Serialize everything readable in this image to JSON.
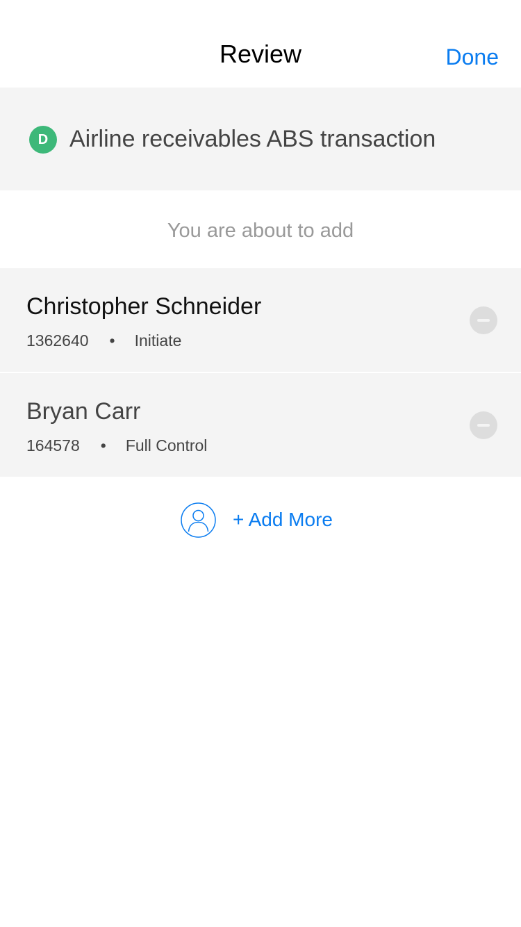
{
  "navbar": {
    "title": "Review",
    "done_label": "Done"
  },
  "deal": {
    "badge_letter": "D",
    "badge_color": "#3db879",
    "title": "Airline receivables ABS transaction"
  },
  "section": {
    "label": "You are about to add"
  },
  "users": [
    {
      "name": "Christopher Schneider",
      "id": "1362640",
      "separator": "•",
      "permission": "Initiate"
    },
    {
      "name": "Bryan Carr",
      "id": "164578",
      "separator": "•",
      "permission": "Full Control"
    }
  ],
  "add_more": {
    "icon": "user-icon",
    "label": "+ Add More"
  },
  "colors": {
    "accent": "#0a7cf0",
    "row_background": "#f4f4f4",
    "muted_text": "#999999"
  }
}
